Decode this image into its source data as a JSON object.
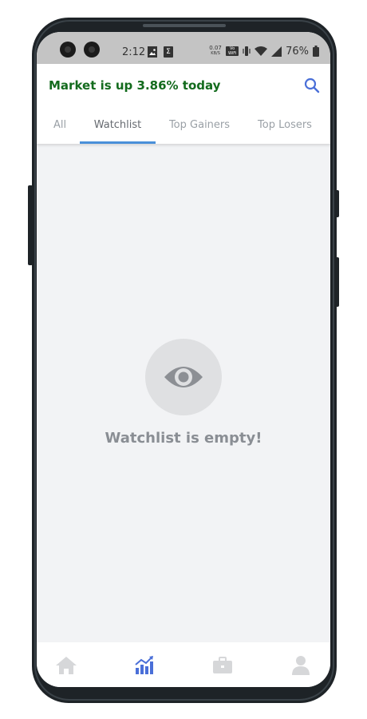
{
  "status_bar": {
    "time": "2:12",
    "net_speed_value": "0.07",
    "net_speed_unit": "KB/S",
    "wifi_badge_top": "Vo",
    "wifi_badge_bottom": "WiFi",
    "battery_percent": "76%"
  },
  "header": {
    "market_status": "Market is up 3.86% today",
    "market_status_color": "#136b1d"
  },
  "tabs": [
    {
      "label": "All",
      "active": false
    },
    {
      "label": "Watchlist",
      "active": true
    },
    {
      "label": "Top Gainers",
      "active": false
    },
    {
      "label": "Top Losers",
      "active": false
    }
  ],
  "empty_state": {
    "icon": "eye-icon",
    "message": "Watchlist is empty!"
  },
  "bottom_nav": {
    "items": [
      {
        "icon": "home-icon",
        "active": false
      },
      {
        "icon": "chart-icon",
        "active": true
      },
      {
        "icon": "briefcase-icon",
        "active": false
      },
      {
        "icon": "user-icon",
        "active": false
      }
    ],
    "active_color": "#4a6fd8",
    "inactive_color": "#d6d7d9"
  },
  "colors": {
    "accent": "#4a90d9",
    "search_icon": "#4a6fd8"
  }
}
